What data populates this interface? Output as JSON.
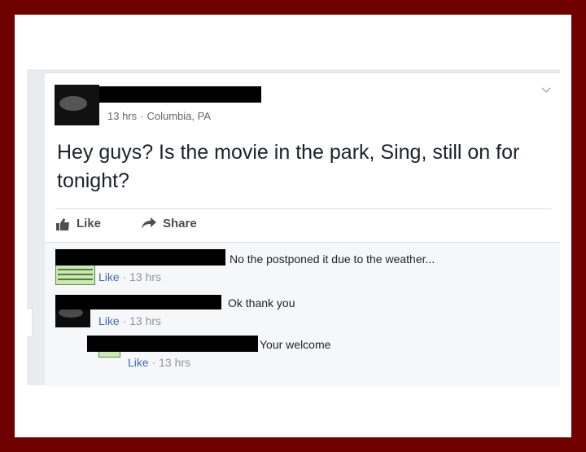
{
  "post": {
    "time": "13 hrs",
    "separator": "·",
    "location": "Columbia, PA",
    "text": "Hey guys? Is the movie in the park, Sing, still on for tonight?",
    "actions": {
      "like": "Like",
      "share": "Share"
    }
  },
  "comments": [
    {
      "text": "No the postponed it due to the weather...",
      "like": "Like",
      "separator": "·",
      "time": "13 hrs"
    },
    {
      "text": "Ok thank you",
      "like": "Like",
      "separator": "·",
      "time": "13 hrs"
    },
    {
      "text": "Your welcome",
      "like": "Like",
      "separator": "·",
      "time": "13 hrs"
    }
  ],
  "colors": {
    "frame": "#6e0000",
    "link": "#4267b2",
    "muted": "#90949c"
  },
  "icons": [
    "chevron-down-icon",
    "thumbs-up-icon",
    "share-arrow-icon"
  ]
}
